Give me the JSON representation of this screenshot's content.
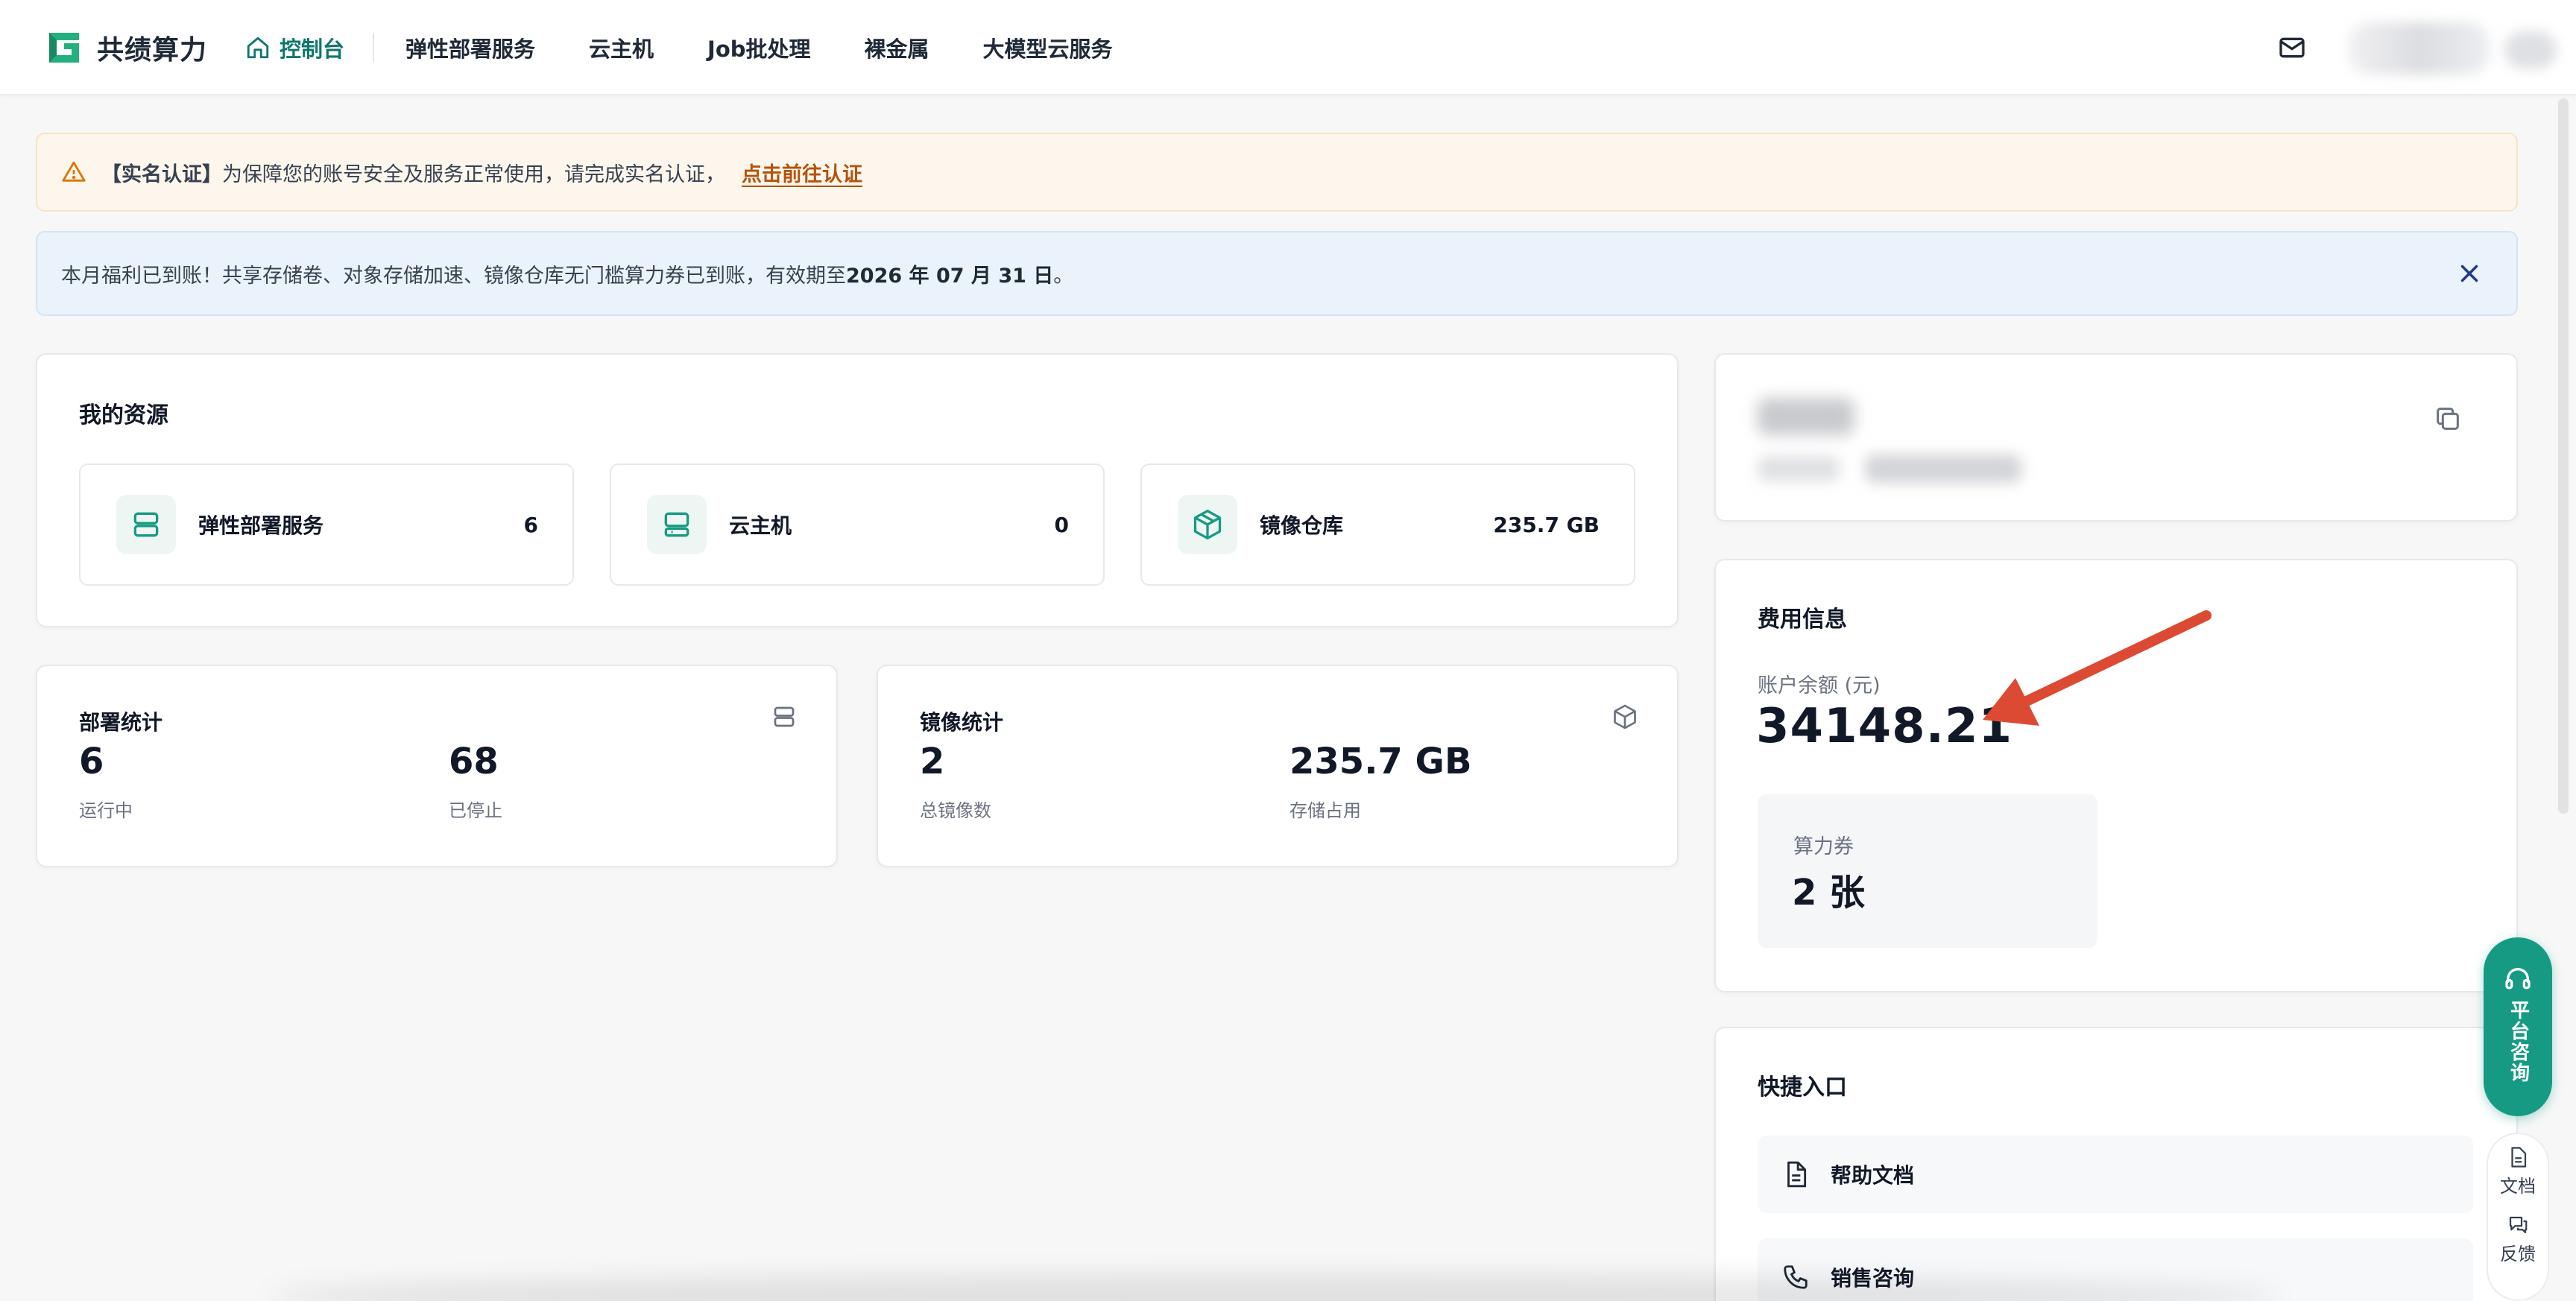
{
  "header": {
    "brand": "共绩算力",
    "nav": [
      {
        "label": "控制台",
        "active": true,
        "icon": "home-icon"
      },
      {
        "label": "弹性部署服务"
      },
      {
        "label": "云主机"
      },
      {
        "label": "Job批处理"
      },
      {
        "label": "裸金属"
      },
      {
        "label": "大模型云服务"
      }
    ],
    "icons": {
      "mail": "mail-icon"
    }
  },
  "alerts": {
    "verify": {
      "prefix": "【实名认证】",
      "text": "为保障您的账号安全及服务正常使用，请完成实名认证，",
      "link": "点击前往认证"
    },
    "benefit": {
      "text": "本月福利已到账！共享存储卷、对象存储加速、镜像仓库无门槛算力券已到账，有效期至 ",
      "date": "2026 年 07 月 31 日",
      "suffix": "。"
    }
  },
  "resources": {
    "title": "我的资源",
    "items": [
      {
        "label": "弹性部署服务",
        "value": "6",
        "icon": "server-stack-icon"
      },
      {
        "label": "云主机",
        "value": "0",
        "icon": "cloud-host-icon"
      },
      {
        "label": "镜像仓库",
        "value": "235.7 GB",
        "icon": "package-icon"
      }
    ]
  },
  "deploy_stats": {
    "title": "部署统计",
    "running_value": "6",
    "running_label": "运行中",
    "stopped_value": "68",
    "stopped_label": "已停止"
  },
  "image_stats": {
    "title": "镜像统计",
    "count_value": "2",
    "count_label": "总镜像数",
    "storage_value": "235.7 GB",
    "storage_label": "存储占用"
  },
  "fees": {
    "title": "费用信息",
    "balance_label": "账户余额 (元)",
    "balance_value": "34148.21",
    "coupon_label": "算力券",
    "coupon_value": "2 张"
  },
  "quick": {
    "title": "快捷入口",
    "items": [
      {
        "label": "帮助文档",
        "icon": "document-icon"
      },
      {
        "label": "销售咨询",
        "icon": "phone-icon"
      }
    ]
  },
  "floating": {
    "consult_label": "平台咨询",
    "doc_label": "文档",
    "feedback_label": "反馈"
  },
  "colors": {
    "brand": "#0f766e",
    "accent": "#179a83",
    "warning_link": "#b45309",
    "annotation_arrow": "#dc4a34"
  }
}
